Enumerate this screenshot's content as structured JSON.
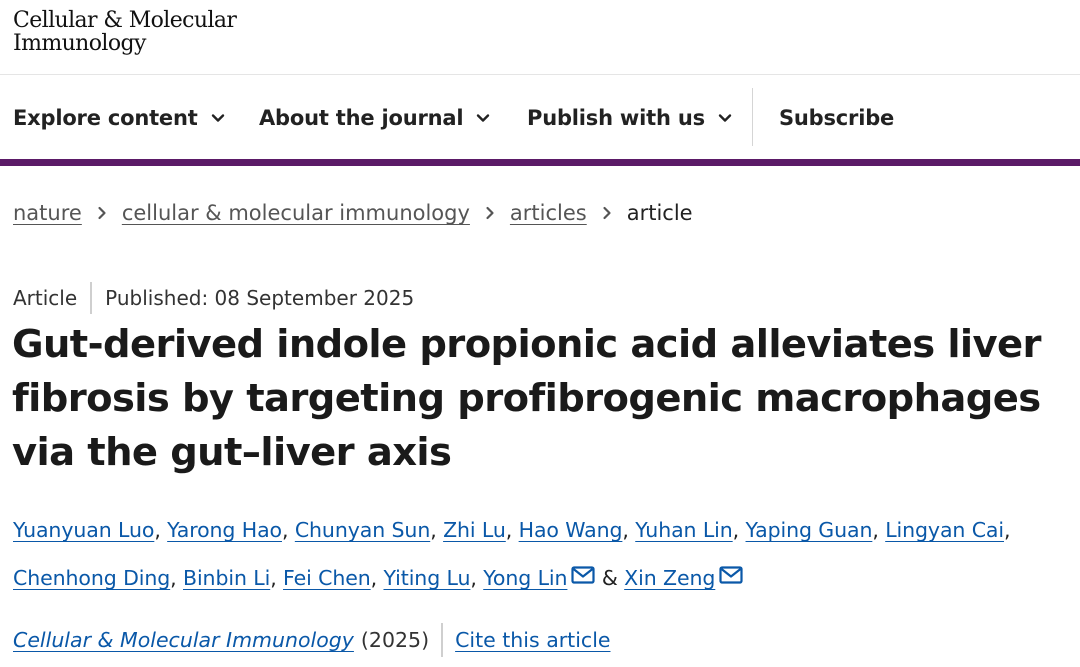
{
  "header": {
    "logo_line1": "Cellular & Molecular",
    "logo_line2": "Immunology"
  },
  "nav": {
    "items": [
      {
        "label": "Explore content",
        "icon": "chevron-down-icon"
      },
      {
        "label": "About the journal",
        "icon": "chevron-down-icon"
      },
      {
        "label": "Publish with us",
        "icon": "chevron-down-icon"
      },
      {
        "label": "Subscribe"
      }
    ],
    "accent_color": "#5b1a67"
  },
  "breadcrumb": {
    "items": [
      "nature",
      "cellular & molecular immunology",
      "articles"
    ],
    "current": "article"
  },
  "article": {
    "type": "Article",
    "published": "Published: 08 September 2025",
    "title": "Gut-derived indole propionic acid alleviates liver fibrosis by targeting profibrogenic macrophages via the gut–liver axis",
    "authors": [
      "Yuanyuan Luo",
      "Yarong Hao",
      "Chunyan Sun",
      "Zhi Lu",
      "Hao Wang",
      "Yuhan Lin",
      "Yaping Guan",
      "Lingyan Cai",
      "Chenhong Ding",
      "Binbin Li",
      "Fei Chen",
      "Yiting Lu",
      "Yong Lin",
      "Xin Zeng"
    ],
    "author_separator": ", ",
    "author_last_separator": "&",
    "link_color": "#0a58a8"
  },
  "citation": {
    "journal": "Cellular & Molecular Immunology",
    "year": "(2025)",
    "cite_label": "Cite this article"
  }
}
